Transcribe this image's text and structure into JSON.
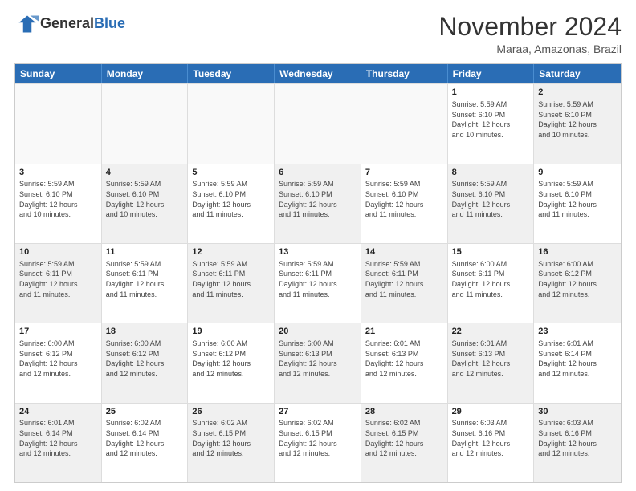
{
  "logo": {
    "general": "General",
    "blue": "Blue"
  },
  "title": "November 2024",
  "location": "Maraa, Amazonas, Brazil",
  "days": [
    "Sunday",
    "Monday",
    "Tuesday",
    "Wednesday",
    "Thursday",
    "Friday",
    "Saturday"
  ],
  "rows": [
    [
      {
        "day": "",
        "info": "",
        "empty": true
      },
      {
        "day": "",
        "info": "",
        "empty": true
      },
      {
        "day": "",
        "info": "",
        "empty": true
      },
      {
        "day": "",
        "info": "",
        "empty": true
      },
      {
        "day": "",
        "info": "",
        "empty": true
      },
      {
        "day": "1",
        "info": "Sunrise: 5:59 AM\nSunset: 6:10 PM\nDaylight: 12 hours\nand 10 minutes.",
        "empty": false
      },
      {
        "day": "2",
        "info": "Sunrise: 5:59 AM\nSunset: 6:10 PM\nDaylight: 12 hours\nand 10 minutes.",
        "empty": false,
        "shaded": true
      }
    ],
    [
      {
        "day": "3",
        "info": "Sunrise: 5:59 AM\nSunset: 6:10 PM\nDaylight: 12 hours\nand 10 minutes.",
        "empty": false
      },
      {
        "day": "4",
        "info": "Sunrise: 5:59 AM\nSunset: 6:10 PM\nDaylight: 12 hours\nand 10 minutes.",
        "empty": false,
        "shaded": true
      },
      {
        "day": "5",
        "info": "Sunrise: 5:59 AM\nSunset: 6:10 PM\nDaylight: 12 hours\nand 11 minutes.",
        "empty": false
      },
      {
        "day": "6",
        "info": "Sunrise: 5:59 AM\nSunset: 6:10 PM\nDaylight: 12 hours\nand 11 minutes.",
        "empty": false,
        "shaded": true
      },
      {
        "day": "7",
        "info": "Sunrise: 5:59 AM\nSunset: 6:10 PM\nDaylight: 12 hours\nand 11 minutes.",
        "empty": false
      },
      {
        "day": "8",
        "info": "Sunrise: 5:59 AM\nSunset: 6:10 PM\nDaylight: 12 hours\nand 11 minutes.",
        "empty": false,
        "shaded": true
      },
      {
        "day": "9",
        "info": "Sunrise: 5:59 AM\nSunset: 6:10 PM\nDaylight: 12 hours\nand 11 minutes.",
        "empty": false
      }
    ],
    [
      {
        "day": "10",
        "info": "Sunrise: 5:59 AM\nSunset: 6:11 PM\nDaylight: 12 hours\nand 11 minutes.",
        "empty": false,
        "shaded": true
      },
      {
        "day": "11",
        "info": "Sunrise: 5:59 AM\nSunset: 6:11 PM\nDaylight: 12 hours\nand 11 minutes.",
        "empty": false
      },
      {
        "day": "12",
        "info": "Sunrise: 5:59 AM\nSunset: 6:11 PM\nDaylight: 12 hours\nand 11 minutes.",
        "empty": false,
        "shaded": true
      },
      {
        "day": "13",
        "info": "Sunrise: 5:59 AM\nSunset: 6:11 PM\nDaylight: 12 hours\nand 11 minutes.",
        "empty": false
      },
      {
        "day": "14",
        "info": "Sunrise: 5:59 AM\nSunset: 6:11 PM\nDaylight: 12 hours\nand 11 minutes.",
        "empty": false,
        "shaded": true
      },
      {
        "day": "15",
        "info": "Sunrise: 6:00 AM\nSunset: 6:11 PM\nDaylight: 12 hours\nand 11 minutes.",
        "empty": false
      },
      {
        "day": "16",
        "info": "Sunrise: 6:00 AM\nSunset: 6:12 PM\nDaylight: 12 hours\nand 12 minutes.",
        "empty": false,
        "shaded": true
      }
    ],
    [
      {
        "day": "17",
        "info": "Sunrise: 6:00 AM\nSunset: 6:12 PM\nDaylight: 12 hours\nand 12 minutes.",
        "empty": false
      },
      {
        "day": "18",
        "info": "Sunrise: 6:00 AM\nSunset: 6:12 PM\nDaylight: 12 hours\nand 12 minutes.",
        "empty": false,
        "shaded": true
      },
      {
        "day": "19",
        "info": "Sunrise: 6:00 AM\nSunset: 6:12 PM\nDaylight: 12 hours\nand 12 minutes.",
        "empty": false
      },
      {
        "day": "20",
        "info": "Sunrise: 6:00 AM\nSunset: 6:13 PM\nDaylight: 12 hours\nand 12 minutes.",
        "empty": false,
        "shaded": true
      },
      {
        "day": "21",
        "info": "Sunrise: 6:01 AM\nSunset: 6:13 PM\nDaylight: 12 hours\nand 12 minutes.",
        "empty": false
      },
      {
        "day": "22",
        "info": "Sunrise: 6:01 AM\nSunset: 6:13 PM\nDaylight: 12 hours\nand 12 minutes.",
        "empty": false,
        "shaded": true
      },
      {
        "day": "23",
        "info": "Sunrise: 6:01 AM\nSunset: 6:14 PM\nDaylight: 12 hours\nand 12 minutes.",
        "empty": false
      }
    ],
    [
      {
        "day": "24",
        "info": "Sunrise: 6:01 AM\nSunset: 6:14 PM\nDaylight: 12 hours\nand 12 minutes.",
        "empty": false,
        "shaded": true
      },
      {
        "day": "25",
        "info": "Sunrise: 6:02 AM\nSunset: 6:14 PM\nDaylight: 12 hours\nand 12 minutes.",
        "empty": false
      },
      {
        "day": "26",
        "info": "Sunrise: 6:02 AM\nSunset: 6:15 PM\nDaylight: 12 hours\nand 12 minutes.",
        "empty": false,
        "shaded": true
      },
      {
        "day": "27",
        "info": "Sunrise: 6:02 AM\nSunset: 6:15 PM\nDaylight: 12 hours\nand 12 minutes.",
        "empty": false
      },
      {
        "day": "28",
        "info": "Sunrise: 6:02 AM\nSunset: 6:15 PM\nDaylight: 12 hours\nand 12 minutes.",
        "empty": false,
        "shaded": true
      },
      {
        "day": "29",
        "info": "Sunrise: 6:03 AM\nSunset: 6:16 PM\nDaylight: 12 hours\nand 12 minutes.",
        "empty": false
      },
      {
        "day": "30",
        "info": "Sunrise: 6:03 AM\nSunset: 6:16 PM\nDaylight: 12 hours\nand 12 minutes.",
        "empty": false,
        "shaded": true
      }
    ]
  ]
}
